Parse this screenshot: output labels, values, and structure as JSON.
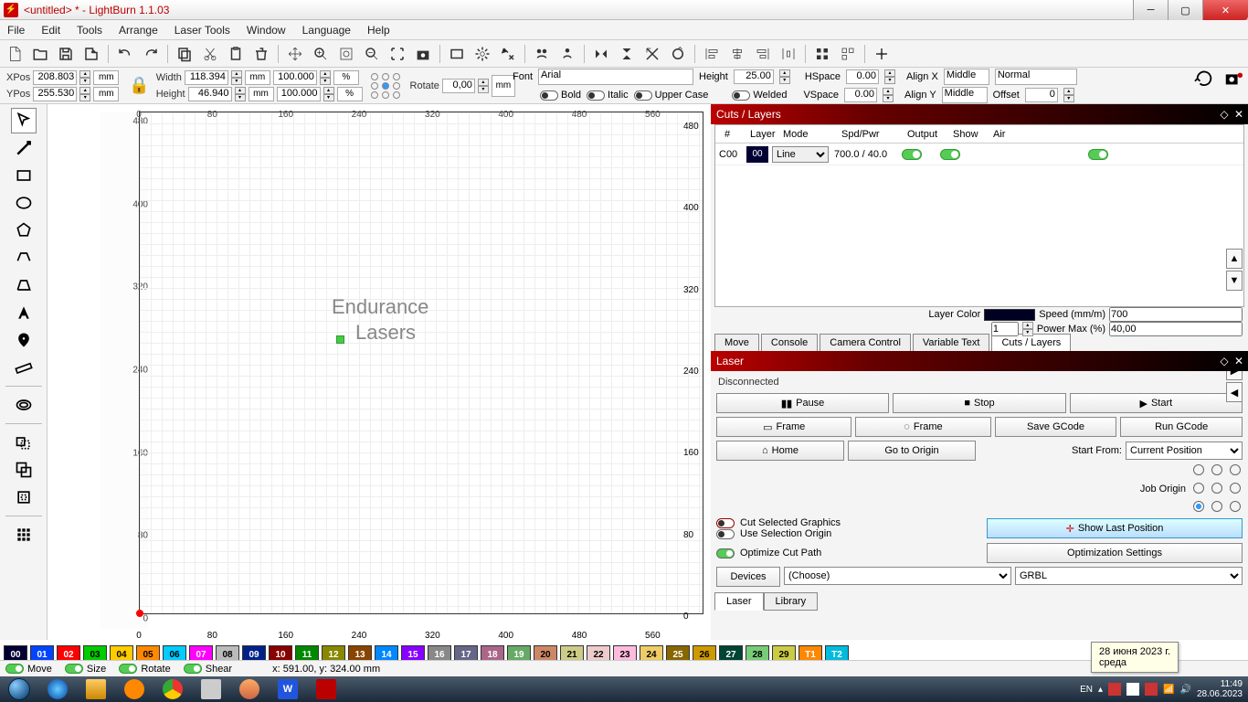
{
  "window": {
    "title": "<untitled> * - LightBurn 1.1.03"
  },
  "menu": [
    "File",
    "Edit",
    "Tools",
    "Arrange",
    "Laser Tools",
    "Window",
    "Language",
    "Help"
  ],
  "props": {
    "xpos_label": "XPos",
    "xpos": "208.803",
    "ypos_label": "YPos",
    "ypos": "255.530",
    "width_label": "Width",
    "width": "118.394",
    "height_label": "Height",
    "height": "46.940",
    "pct1": "100.000",
    "pct2": "100.000",
    "rotate_label": "Rotate",
    "rotate": "0,00",
    "unit": "mm"
  },
  "font": {
    "label": "Font",
    "name": "Arial",
    "height_label": "Height",
    "height": "25.00",
    "hspace_label": "HSpace",
    "hspace": "0.00",
    "alignx_label": "Align X",
    "alignx": "Middle",
    "normal": "Normal",
    "bold": "Bold",
    "italic": "Italic",
    "upper": "Upper Case",
    "welded": "Welded",
    "vspace_label": "VSpace",
    "vspace": "0.00",
    "aligny_label": "Align Y",
    "aligny": "Middle",
    "offset_label": "Offset",
    "offset": "0"
  },
  "canvas": {
    "text1": "Endurance",
    "text2": "Lasers",
    "yticks": [
      "480",
      "400",
      "320",
      "240",
      "160",
      "80",
      "0"
    ],
    "xticks": [
      "0",
      "80",
      "160",
      "240",
      "320",
      "400",
      "480",
      "560"
    ]
  },
  "cuts": {
    "title": "Cuts / Layers",
    "cols": {
      "num": "#",
      "layer": "Layer",
      "mode": "Mode",
      "spd": "Spd/Pwr",
      "output": "Output",
      "show": "Show",
      "air": "Air"
    },
    "row": {
      "id": "C00",
      "layer": "00",
      "mode": "Line",
      "spd": "700.0 / 40.0"
    },
    "tabs": [
      "Move",
      "Console",
      "Camera Control",
      "Variable Text",
      "Cuts / Layers"
    ],
    "layercolor": "Layer Color",
    "speed_label": "Speed (mm/m)",
    "speed": "700",
    "power_label": "Power Max (%)",
    "power": "40,00",
    "passes": "1"
  },
  "laser": {
    "title": "Laser",
    "status": "Disconnected",
    "pause": "Pause",
    "stop": "Stop",
    "start": "Start",
    "frame": "Frame",
    "frame2": "Frame",
    "savegc": "Save GCode",
    "rungc": "Run GCode",
    "home": "Home",
    "gotoorigin": "Go to Origin",
    "startfrom": "Start From:",
    "startfrom_val": "Current Position",
    "joborigin": "Job Origin",
    "cutsel": "Cut Selected Graphics",
    "useselorig": "Use Selection Origin",
    "showlast": "Show Last Position",
    "optcut": "Optimize Cut Path",
    "optset": "Optimization Settings",
    "devices": "Devices",
    "choose": "(Choose)",
    "grbl": "GRBL",
    "bottomtabs": [
      "Laser",
      "Library"
    ]
  },
  "palette": [
    {
      "c": "#003",
      "t": "00",
      "tc": "#fff"
    },
    {
      "c": "#04f",
      "t": "01",
      "tc": "#fff"
    },
    {
      "c": "#f00",
      "t": "02",
      "tc": "#fff"
    },
    {
      "c": "#0c0",
      "t": "03",
      "tc": "#000"
    },
    {
      "c": "#fc0",
      "t": "04",
      "tc": "#000"
    },
    {
      "c": "#f80",
      "t": "05",
      "tc": "#000"
    },
    {
      "c": "#0cf",
      "t": "06",
      "tc": "#000"
    },
    {
      "c": "#f0f",
      "t": "07",
      "tc": "#fff"
    },
    {
      "c": "#bbb",
      "t": "08",
      "tc": "#000"
    },
    {
      "c": "#028",
      "t": "09",
      "tc": "#fff"
    },
    {
      "c": "#800",
      "t": "10",
      "tc": "#fff"
    },
    {
      "c": "#080",
      "t": "11",
      "tc": "#fff"
    },
    {
      "c": "#880",
      "t": "12",
      "tc": "#fff"
    },
    {
      "c": "#840",
      "t": "13",
      "tc": "#fff"
    },
    {
      "c": "#08f",
      "t": "14",
      "tc": "#fff"
    },
    {
      "c": "#80f",
      "t": "15",
      "tc": "#fff"
    },
    {
      "c": "#888",
      "t": "16",
      "tc": "#fff"
    },
    {
      "c": "#668",
      "t": "17",
      "tc": "#fff"
    },
    {
      "c": "#a68",
      "t": "18",
      "tc": "#fff"
    },
    {
      "c": "#6a6",
      "t": "19",
      "tc": "#fff"
    },
    {
      "c": "#c86",
      "t": "20",
      "tc": "#000"
    },
    {
      "c": "#cc8",
      "t": "21",
      "tc": "#000"
    },
    {
      "c": "#ecc",
      "t": "22",
      "tc": "#000"
    },
    {
      "c": "#fbd",
      "t": "23",
      "tc": "#000"
    },
    {
      "c": "#ec6",
      "t": "24",
      "tc": "#000"
    },
    {
      "c": "#860",
      "t": "25",
      "tc": "#fff"
    },
    {
      "c": "#c90",
      "t": "26",
      "tc": "#000"
    },
    {
      "c": "#043",
      "t": "27",
      "tc": "#fff"
    },
    {
      "c": "#7c7",
      "t": "28",
      "tc": "#000"
    },
    {
      "c": "#cc4",
      "t": "29",
      "tc": "#000"
    },
    {
      "c": "#f80",
      "t": "T1",
      "tc": "#fff"
    },
    {
      "c": "#0bd",
      "t": "T2",
      "tc": "#fff"
    }
  ],
  "status": {
    "move": "Move",
    "size": "Size",
    "rotate": "Rotate",
    "shear": "Shear",
    "coords": "x: 591.00, y: 324.00 mm"
  },
  "tooltip": {
    "line1": "28 июня 2023 г.",
    "line2": "среда"
  },
  "tray": {
    "lang": "EN",
    "time": "11:49",
    "date": "28.06.2023"
  }
}
